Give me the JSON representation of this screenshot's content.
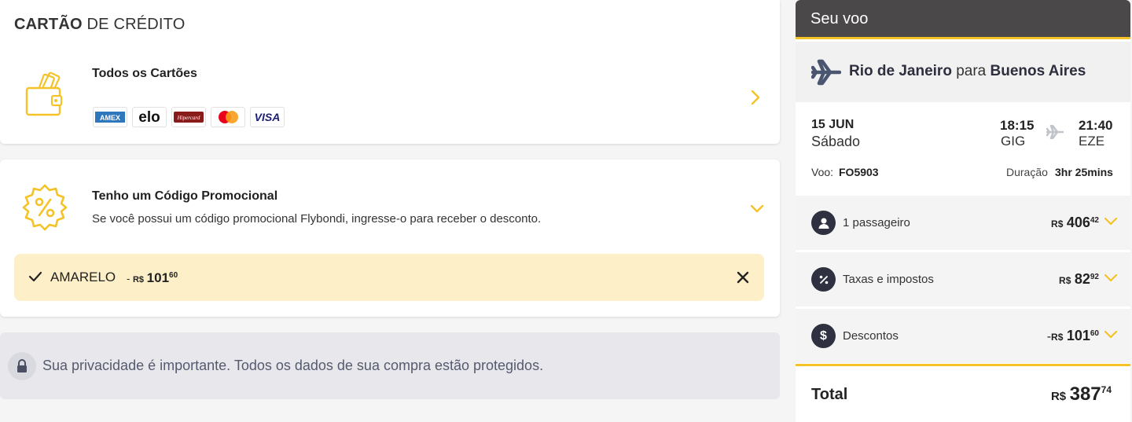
{
  "payment": {
    "section_title_bold": "CARTÃO",
    "section_title_rest": " DE CRÉDITO",
    "cards_title": "Todos os Cartões",
    "brands": [
      "AMEX",
      "elo",
      "Hipercard",
      "Mastercard",
      "VISA"
    ]
  },
  "promo": {
    "title": "Tenho um Código Promocional",
    "description": "Se você possui um código promocional Flybondi, ingresse-o para receber o desconto.",
    "applied_code": "AMARELO",
    "discount_prefix": "-",
    "discount_currency": "R$",
    "discount_int": "101",
    "discount_cents": "60"
  },
  "privacy": {
    "text": "Sua privacidade é importante. Todos os dados de sua compra estão protegidos."
  },
  "summary": {
    "header": "Seu voo",
    "origin": "Rio de Janeiro",
    "connector": "para",
    "destination": "Buenos Aires",
    "date": "15 JUN",
    "weekday": "Sábado",
    "dep_time": "18:15",
    "dep_code": "GIG",
    "arr_time": "21:40",
    "arr_code": "EZE",
    "flight_label": "Voo:",
    "flight_number": "FO5903",
    "duration_label": "Duração",
    "duration": "3hr 25mins",
    "rows": [
      {
        "label": "1 passageiro",
        "sign": "",
        "currency": "R$",
        "int": "406",
        "cents": "42"
      },
      {
        "label": "Taxas e impostos",
        "sign": "",
        "currency": "R$",
        "int": "82",
        "cents": "92"
      },
      {
        "label": "Descontos",
        "sign": "-",
        "currency": "R$",
        "int": "101",
        "cents": "60"
      }
    ],
    "total_label": "Total",
    "total_currency": "R$",
    "total_int": "387",
    "total_cents": "74"
  },
  "colors": {
    "accent": "#f5c228",
    "dark": "#4a4848",
    "promo_bg": "#fdefc8"
  }
}
